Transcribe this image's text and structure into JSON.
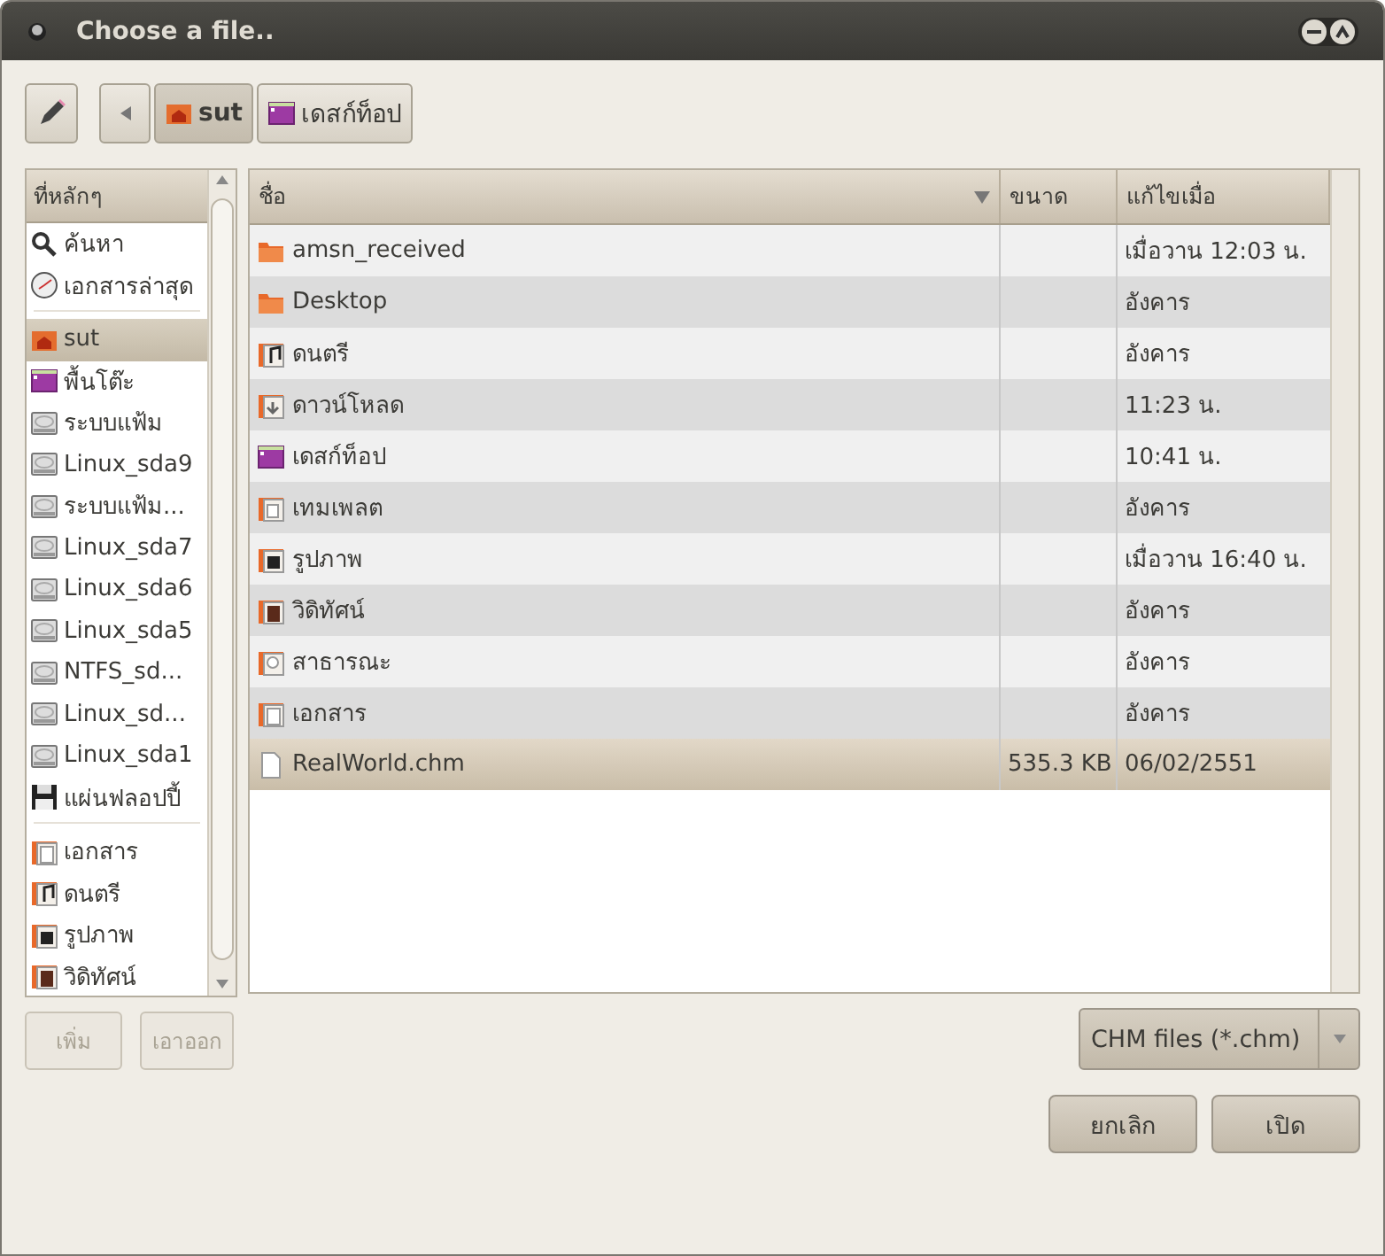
{
  "window": {
    "title": "Choose a file.."
  },
  "path_bar": {
    "segments": [
      {
        "label": "sut",
        "kind": "home",
        "selected": true
      },
      {
        "label": "เดสก์ท็อป",
        "kind": "desktop",
        "selected": false
      }
    ]
  },
  "sidebar": {
    "header": "ที่หลักๆ",
    "groups": [
      [
        {
          "label": "ค้นหา",
          "kind": "search",
          "selected": false
        },
        {
          "label": "เอกสารล่าสุด",
          "kind": "recent",
          "selected": false
        }
      ],
      [
        {
          "label": "sut",
          "kind": "home",
          "selected": true
        },
        {
          "label": "พื้นโต๊ะ",
          "kind": "desktop",
          "selected": false
        },
        {
          "label": "ระบบแฟ้ม",
          "kind": "drive",
          "selected": false
        },
        {
          "label": "Linux_sda9",
          "kind": "drive",
          "selected": false
        },
        {
          "label": "ระบบแฟ้ม...",
          "kind": "drive",
          "selected": false
        },
        {
          "label": "Linux_sda7",
          "kind": "drive",
          "selected": false
        },
        {
          "label": "Linux_sda6",
          "kind": "drive",
          "selected": false
        },
        {
          "label": "Linux_sda5",
          "kind": "drive",
          "selected": false
        },
        {
          "label": "NTFS_sd...",
          "kind": "drive",
          "selected": false
        },
        {
          "label": "Linux_sd...",
          "kind": "drive",
          "selected": false
        },
        {
          "label": "Linux_sda1",
          "kind": "drive",
          "selected": false
        },
        {
          "label": "แผ่นฟลอปปี้",
          "kind": "floppy",
          "selected": false
        }
      ],
      [
        {
          "label": "เอกสาร",
          "kind": "documents",
          "selected": false
        },
        {
          "label": "ดนตรี",
          "kind": "music",
          "selected": false
        },
        {
          "label": "รูปภาพ",
          "kind": "pictures",
          "selected": false
        },
        {
          "label": "วิดิทัศน์",
          "kind": "videos",
          "selected": false
        }
      ]
    ],
    "buttons": [
      {
        "label": "เพิ่ม",
        "disabled": true
      },
      {
        "label": "เอาออก",
        "disabled": true
      }
    ]
  },
  "table": {
    "columns": [
      "ชื่อ",
      "ขนาด",
      "แก้ไขเมื่อ"
    ],
    "rows": [
      {
        "name": "amsn_received",
        "kind": "folder",
        "size": "",
        "modified": "เมื่อวาน 12:03 น.",
        "selected": false
      },
      {
        "name": "Desktop",
        "kind": "folder",
        "size": "",
        "modified": "อังคาร",
        "selected": false
      },
      {
        "name": "ดนตรี",
        "kind": "music",
        "size": "",
        "modified": "อังคาร",
        "selected": false
      },
      {
        "name": "ดาวน์โหลด",
        "kind": "download",
        "size": "",
        "modified": "11:23 น.",
        "selected": false
      },
      {
        "name": "เดสก์ท็อป",
        "kind": "desktop",
        "size": "",
        "modified": "10:41 น.",
        "selected": false
      },
      {
        "name": "เทมเพลต",
        "kind": "templates",
        "size": "",
        "modified": "อังคาร",
        "selected": false
      },
      {
        "name": "รูปภาพ",
        "kind": "pictures",
        "size": "",
        "modified": "เมื่อวาน 16:40 น.",
        "selected": false
      },
      {
        "name": "วิดิทัศน์",
        "kind": "videos",
        "size": "",
        "modified": "อังคาร",
        "selected": false
      },
      {
        "name": "สาธารณะ",
        "kind": "public",
        "size": "",
        "modified": "อังคาร",
        "selected": false
      },
      {
        "name": "เอกสาร",
        "kind": "documents",
        "size": "",
        "modified": "อังคาร",
        "selected": false
      },
      {
        "name": "RealWorld.chm",
        "kind": "file",
        "size": "535.3 KB",
        "modified": "06/02/2551",
        "selected": true
      }
    ]
  },
  "filter": {
    "value": "CHM files (*.chm)"
  },
  "actions": [
    {
      "label": "ยกเลิก"
    },
    {
      "label": "เปิด"
    }
  ]
}
